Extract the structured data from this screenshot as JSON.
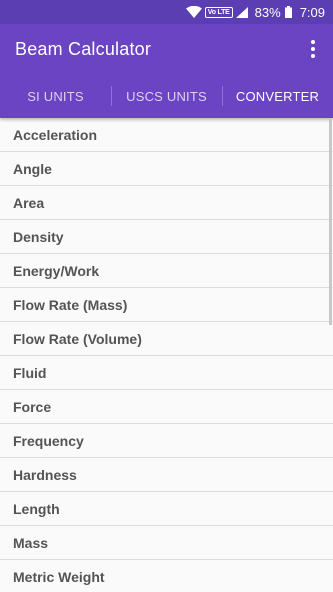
{
  "status_bar": {
    "volte": "Vo LTE",
    "battery": "83%",
    "time": "7:09"
  },
  "app_bar": {
    "title": "Beam Calculator",
    "overflow_icon": "more-vert-icon"
  },
  "tabs": [
    {
      "label": "SI UNITS",
      "active": false
    },
    {
      "label": "USCS UNITS",
      "active": false
    },
    {
      "label": "CONVERTER",
      "active": true
    }
  ],
  "list": [
    "Acceleration",
    "Angle",
    "Area",
    "Density",
    "Energy/Work",
    "Flow Rate (Mass)",
    "Flow Rate (Volume)",
    "Fluid",
    "Force",
    "Frequency",
    "Hardness",
    "Length",
    "Mass",
    "Metric Weight"
  ],
  "colors": {
    "status_bar": "#5b3eb2",
    "primary": "#6a44c2",
    "text": "#545454",
    "divider": "#dcdcdc"
  }
}
